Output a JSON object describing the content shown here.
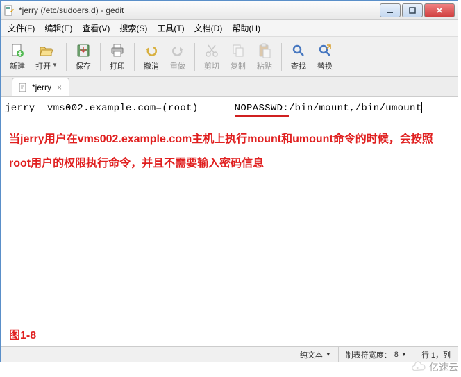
{
  "titlebar": {
    "title": "*jerry (/etc/sudoers.d) - gedit"
  },
  "menubar": {
    "file": "文件(F)",
    "edit": "编辑(E)",
    "view": "查看(V)",
    "search": "搜索(S)",
    "tools": "工具(T)",
    "documents": "文档(D)",
    "help": "帮助(H)"
  },
  "toolbar": {
    "new": "新建",
    "open": "打开",
    "save": "保存",
    "print": "打印",
    "undo": "撤消",
    "redo": "重做",
    "cut": "剪切",
    "copy": "复制",
    "paste": "粘贴",
    "find": "查找",
    "replace": "替换"
  },
  "tab": {
    "label": "*jerry"
  },
  "editor": {
    "p1": "jerry  vms002.example.com=(root)      ",
    "p2": "NOPASSWD:",
    "p3": "/bin/mount,/bin/umount"
  },
  "annotation": {
    "line": "当jerry用户在vms002.example.com主机上执行mount和umount命令的时候，会按照root用户的权限执行命令，并且不需要输入密码信息",
    "figlabel": "图1-8"
  },
  "statusbar": {
    "plaintext": "纯文本",
    "tabwidth_label": "制表符宽度：",
    "tabwidth_val": "8",
    "position": "行 1，列"
  },
  "watermark": {
    "text": "亿速云"
  }
}
